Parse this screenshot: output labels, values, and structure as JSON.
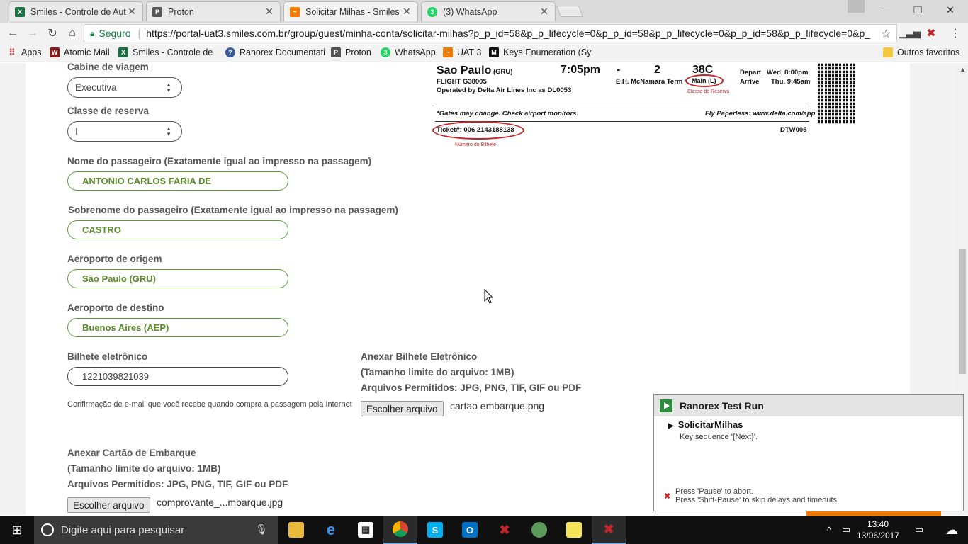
{
  "browser": {
    "tabs": [
      {
        "title": "Smiles - Controle de Aut",
        "icon": "excel-icon",
        "color": "#1d7044"
      },
      {
        "title": "Proton",
        "icon": "proton-icon",
        "color": "#555555"
      },
      {
        "title": "Solicitar Milhas - Smiles",
        "icon": "smiles-icon",
        "color": "#f07c00"
      },
      {
        "title": "(3) WhatsApp",
        "icon": "whatsapp-icon",
        "color": "#25d366"
      }
    ],
    "secure_label": "Seguro",
    "url": "https://portal-uat3.smiles.com.br/group/guest/minha-conta/solicitar-milhas?p_p_id=58&p_p_lifecycle=0&p_p_id=58&p_p_lifecycle=0&p_p_id=58&p_p_lifecycle=0&p_",
    "bookmarks": [
      {
        "label": "Apps",
        "icon": "apps-grid-icon"
      },
      {
        "label": "Atomic Mail",
        "icon": "w-icon"
      },
      {
        "label": "Smiles - Controle de",
        "icon": "excel-icon"
      },
      {
        "label": "Ranorex Documentati",
        "icon": "help-icon"
      },
      {
        "label": "Proton",
        "icon": "proton-icon"
      },
      {
        "label": "WhatsApp",
        "icon": "whatsapp-icon"
      },
      {
        "label": "UAT 3",
        "icon": "smiles-icon"
      },
      {
        "label": "Keys Enumeration (Sy",
        "icon": "m-icon"
      }
    ],
    "other_bookmarks": "Outros favoritos"
  },
  "form": {
    "cabin_label": "Cabine de viagem",
    "cabin_value": "Executiva",
    "class_label": "Classe de reserva",
    "class_value": "I",
    "first_name_label": "Nome do passageiro (Exatamente igual ao impresso na passagem)",
    "first_name_value": "ANTONIO CARLOS FARIA DE",
    "last_name_label": "Sobrenome do passageiro (Exatamente igual ao impresso na passagem)",
    "last_name_value": "CASTRO",
    "origin_label": "Aeroporto de origem",
    "origin_value": "São Paulo (GRU)",
    "dest_label": "Aeroporto de destino",
    "dest_value": "Buenos Aires (AEP)",
    "ticket_label": "Bilhete eletrônico",
    "ticket_value": "1221039821039",
    "ticket_hint": "Confirmação de e-mail que você recebe quando compra a passagem pela Internet",
    "attach_ticket_title": "Anexar Bilhete Eletrônico",
    "attach_ticket_limit": "(Tamanho limite do arquivo: 1MB)",
    "attach_ticket_types": "Arquivos Permitidos: JPG, PNG, TIF, GIF ou PDF",
    "attach_ticket_button": "Escolher arquivo",
    "attach_ticket_file": "cartao embarque.png",
    "attach_pass_title": "Anexar Cartão de Embarque",
    "attach_pass_limit": "(Tamanho limite do arquivo: 1MB)",
    "attach_pass_types": "Arquivos Permitidos: JPG, PNG, TIF, GIF ou PDF",
    "attach_pass_button": "Escolher arquivo",
    "attach_pass_file": "comprovante_...mbarque.jpg"
  },
  "boarding_pass": {
    "city": "Sao Paulo",
    "city_code": "(GRU)",
    "time": "7:05pm",
    "dash": "-",
    "gate": "2",
    "seat": "38C",
    "depart_label": "Depart",
    "depart_value": "Wed, 8:00pm",
    "arrive_label": "Arrive",
    "arrive_value": "Thu, 9:45am",
    "flight": "FLIGHT G38005",
    "operated": "Operated by Delta Air Lines Inc as DL0053",
    "terminal": "E.H. McNamara Term",
    "cabin": "Main (L)",
    "cabin_note": "Classe de Reserva",
    "gates_note": "*Gates may change. Check airport monitors.",
    "paperless": "Fly Paperless: www.delta.com/app",
    "ticket": "Ticket#: 006 2143188138",
    "ticket_note": "Número do Bilhete",
    "code": "DTW005"
  },
  "ranorex": {
    "title": "Ranorex Test Run",
    "test": "SolicitarMilhas",
    "step": "Key sequence '{Next}'.",
    "footer1": "Press 'Pause' to abort.",
    "footer2": "Press 'Shift-Pause' to skip delays and timeouts."
  },
  "taskbar": {
    "search_placeholder": "Digite aqui para pesquisar",
    "time": "13:40",
    "date": "13/06/2017"
  }
}
